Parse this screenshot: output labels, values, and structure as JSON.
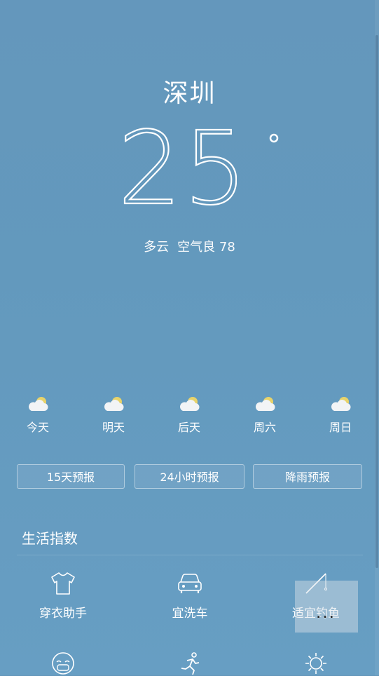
{
  "city": "深圳",
  "temperature": "25",
  "condition": "多云",
  "air_quality": "空气良 78",
  "forecast": [
    {
      "label": "今天",
      "icon": "partly-cloudy-icon"
    },
    {
      "label": "明天",
      "icon": "partly-cloudy-icon"
    },
    {
      "label": "后天",
      "icon": "partly-cloudy-icon"
    },
    {
      "label": "周六",
      "icon": "partly-cloudy-icon"
    },
    {
      "label": "周日",
      "icon": "partly-cloudy-icon"
    }
  ],
  "buttons": {
    "forecast_15": "15天预报",
    "forecast_24h": "24小时预报",
    "rain_forecast": "降雨预报"
  },
  "life_index": {
    "title": "生活指数",
    "items": [
      {
        "label": "穿衣助手",
        "icon": "tshirt-icon"
      },
      {
        "label": "宜洗车",
        "icon": "car-icon"
      },
      {
        "label": "适宜钓鱼",
        "icon": "fishing-rod-icon"
      },
      {
        "label": "",
        "icon": "face-mask-icon"
      },
      {
        "label": "",
        "icon": "running-icon"
      },
      {
        "label": "",
        "icon": "sun-icon"
      }
    ]
  },
  "overlay": {
    "dots": "..."
  },
  "colors": {
    "background": "#6496ba",
    "sun": "#e8d36a",
    "cloud": "#f2f4f6"
  }
}
